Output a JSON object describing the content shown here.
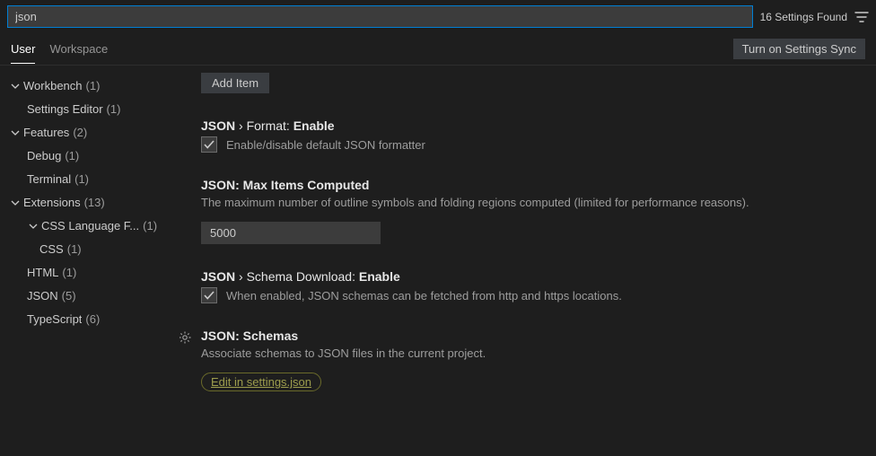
{
  "search": {
    "value": "json",
    "found_text": "16 Settings Found"
  },
  "scope_tabs": {
    "user": "User",
    "workspace": "Workspace"
  },
  "sync_button": "Turn on Settings Sync",
  "sidebar": {
    "workbench": {
      "label": "Workbench",
      "count": "(1)"
    },
    "settings_editor": {
      "label": "Settings Editor",
      "count": "(1)"
    },
    "features": {
      "label": "Features",
      "count": "(2)"
    },
    "debug": {
      "label": "Debug",
      "count": "(1)"
    },
    "terminal": {
      "label": "Terminal",
      "count": "(1)"
    },
    "extensions": {
      "label": "Extensions",
      "count": "(13)"
    },
    "css_lang": {
      "label": "CSS Language F...",
      "count": "(1)"
    },
    "css": {
      "label": "CSS",
      "count": "(1)"
    },
    "html": {
      "label": "HTML",
      "count": "(1)"
    },
    "json": {
      "label": "JSON",
      "count": "(5)"
    },
    "typescript": {
      "label": "TypeScript",
      "count": "(6)"
    }
  },
  "settings": {
    "add_item": "Add Item",
    "format_enable": {
      "prefix": "JSON",
      "sep": " › Format: ",
      "name": "Enable",
      "desc": "Enable/disable default JSON formatter"
    },
    "max_items": {
      "prefix": "JSON:",
      "name": " Max Items Computed",
      "desc": "The maximum number of outline symbols and folding regions computed (limited for performance reasons).",
      "value": "5000"
    },
    "schema_download": {
      "prefix": "JSON",
      "sep": " › Schema Download: ",
      "name": "Enable",
      "desc": "When enabled, JSON schemas can be fetched from http and https locations."
    },
    "schemas": {
      "prefix": "JSON:",
      "name": " Schemas",
      "desc": "Associate schemas to JSON files in the current project.",
      "link": "Edit in settings.json"
    }
  }
}
